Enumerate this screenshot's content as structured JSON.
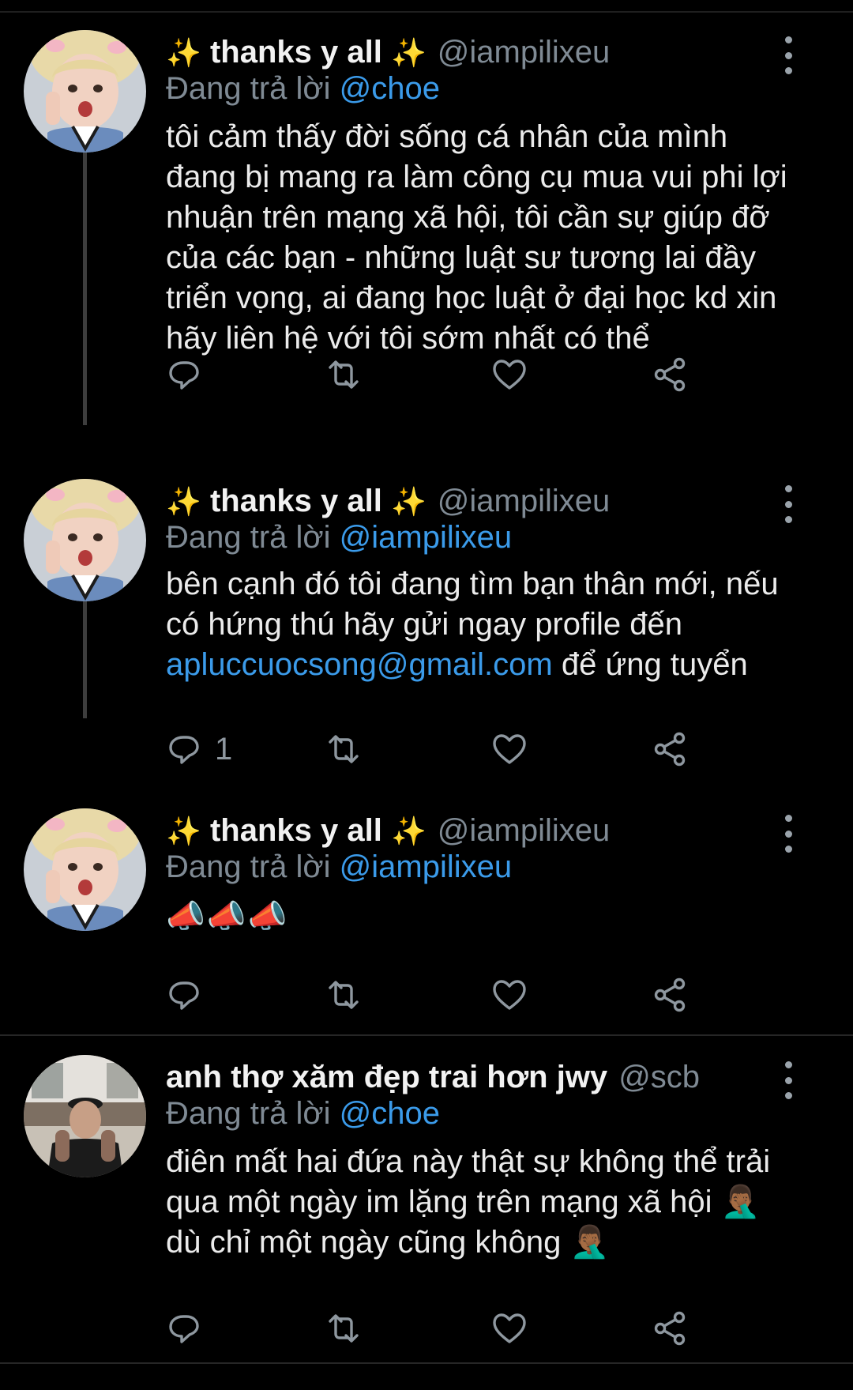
{
  "tweets": [
    {
      "display_name": "thanks y all",
      "display_prefix": "✨",
      "display_suffix": "✨",
      "handle": "@iampilixeu",
      "reply_prefix": "Đang trả lời",
      "reply_to": "@choe",
      "text": "tôi cảm thấy đời sống cá nhân của mình đang bị mang ra làm công cụ mua vui phi lợi nhuận trên mạng xã hội, tôi cần sự giúp đỡ của các bạn - những luật sư tương lai đầy triển vọng, ai đang học luật ở đại học kd xin hãy liên hệ với tôi sớm nhất có thể",
      "reply_count": ""
    },
    {
      "display_name": "thanks y all",
      "display_prefix": "✨",
      "display_suffix": "✨",
      "handle": "@iampilixeu",
      "reply_prefix": "Đang trả lời",
      "reply_to": "@iampilixeu",
      "text_before": "bên cạnh đó tôi đang tìm bạn thân mới, nếu có hứng thú hãy gửi ngay profile đến",
      "email": "apluccuocsong@gmail.com",
      "text_after": "để ứng tuyển",
      "reply_count": "1"
    },
    {
      "display_name": "thanks y all",
      "display_prefix": "✨",
      "display_suffix": "✨",
      "handle": "@iampilixeu",
      "reply_prefix": "Đang trả lời",
      "reply_to": "@iampilixeu",
      "text": "📣📣📣",
      "reply_count": ""
    },
    {
      "display_name": "anh thợ xăm đẹp trai hơn jwy",
      "handle": "@scb",
      "reply_prefix": "Đang trả lời",
      "reply_to": "@choe",
      "text": "điên mất hai đứa này thật sự không thể trải qua một ngày im lặng trên mạng xã hội 🤦🏾‍♂️ dù chỉ một ngày cũng không 🤦🏾‍♂️",
      "reply_count": ""
    }
  ],
  "icons": {
    "reply": "reply-icon",
    "retweet": "retweet-icon",
    "like": "heart-icon",
    "share": "share-icon",
    "more": "more-vertical-icon"
  },
  "colors": {
    "background": "#000000",
    "text": "#ebebeb",
    "secondary": "#7f8a94",
    "accent": "#3b9bea",
    "thread_line": "#3d3d3d"
  }
}
